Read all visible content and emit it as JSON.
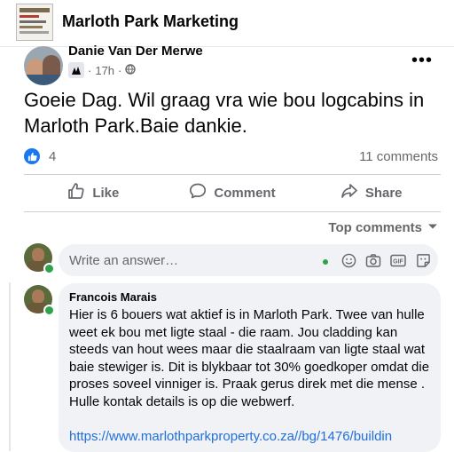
{
  "header": {
    "group_name": "Marloth Park Marketing"
  },
  "post": {
    "author": "Danie Van Der Merwe",
    "time": "17h",
    "text": "Goeie Dag. Wil graag vra wie bou logcabins in Marloth Park.Baie dankie.",
    "reaction_count": "4",
    "comments_count": "11 comments"
  },
  "actions": {
    "like": "Like",
    "comment": "Comment",
    "share": "Share"
  },
  "comments": {
    "sort_label": "Top comments",
    "input_placeholder": "Write an answer…",
    "items": [
      {
        "author": "Francois Marais",
        "text": "Hier is 6 bouers wat aktief is in Marloth Park. Twee van hulle weet ek bou met ligte staal - die raam. Jou cladding kan steeds van hout wees maar die staalraam van ligte staal wat baie stewiger is. Dit is blykbaar tot 30% goedkoper omdat die proses soveel vinniger is. Praak gerus direk met die mense . Hulle kontak details is op die webwerf.",
        "link": "https://www.marlothparkproperty.co.za//bg/1476/buildin"
      }
    ]
  },
  "colors": {
    "accent": "#1877f2",
    "link": "#216fdb",
    "online": "#31a24c",
    "muted_text": "#65676b",
    "bubble_bg": "#f0f2f5"
  },
  "icons": [
    "more-icon",
    "globe-icon",
    "member-badge-icon",
    "like-icon",
    "comment-icon",
    "share-icon",
    "caret-down-icon",
    "emoji-icon",
    "camera-icon",
    "gif-icon",
    "sticker-icon"
  ]
}
